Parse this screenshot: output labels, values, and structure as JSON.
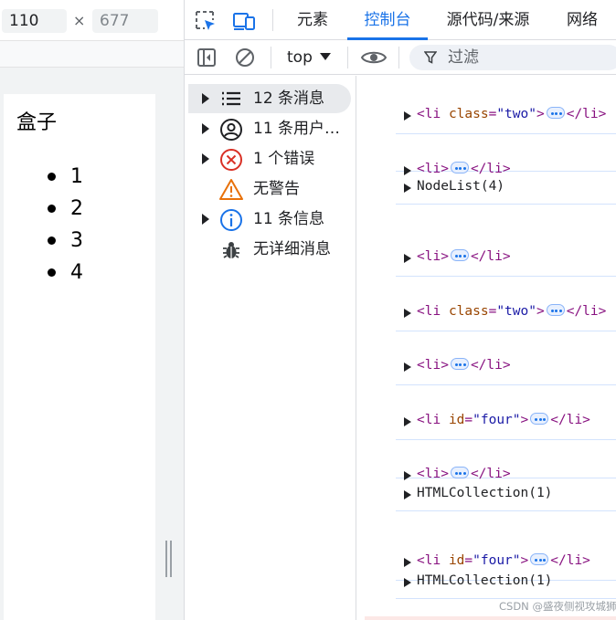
{
  "viewport": {
    "width_value": "110",
    "times": "×",
    "height_placeholder": "677"
  },
  "page": {
    "title": "盒子",
    "list_items": [
      "1",
      "2",
      "3",
      "4"
    ]
  },
  "devtools": {
    "tabs": {
      "elements": "元素",
      "console": "控制台",
      "sources": "源代码/来源",
      "network": "网络"
    },
    "active_tab": "控制台",
    "toolbar": {
      "context": "top",
      "filter_label": "过滤"
    },
    "sidebar": [
      {
        "label": "12 条消息",
        "icon": "list-icon",
        "expandable": true,
        "selected": true
      },
      {
        "label": "11 条用户…",
        "icon": "user-icon",
        "expandable": true,
        "selected": false
      },
      {
        "label": "1 个错误",
        "icon": "error-icon",
        "expandable": true,
        "selected": false
      },
      {
        "label": "无警告",
        "icon": "warning-icon",
        "expandable": false,
        "selected": false
      },
      {
        "label": "11 条信息",
        "icon": "info-icon",
        "expandable": true,
        "selected": false
      },
      {
        "label": "无详细消息",
        "icon": "bug-icon",
        "expandable": false,
        "selected": false
      }
    ],
    "console_entries": [
      {
        "kind": "element",
        "tag": "li",
        "attr": "class",
        "value": "two"
      },
      {
        "kind": "element",
        "tag": "li"
      },
      {
        "kind": "text",
        "text": "NodeList(4)"
      },
      {
        "kind": "element",
        "tag": "li"
      },
      {
        "kind": "element",
        "tag": "li",
        "attr": "class",
        "value": "two"
      },
      {
        "kind": "element",
        "tag": "li"
      },
      {
        "kind": "element",
        "tag": "li",
        "attr": "id",
        "value": "four"
      },
      {
        "kind": "element",
        "tag": "li"
      },
      {
        "kind": "text",
        "text": "HTMLCollection(1)"
      },
      {
        "kind": "element",
        "tag": "li",
        "attr": "id",
        "value": "four"
      },
      {
        "kind": "text",
        "text": "HTMLCollection(1)"
      }
    ]
  },
  "watermark": "CSDN @盛夜侧视攻城狮",
  "colors": {
    "accent": "#1a73e8",
    "tag": "#881280",
    "attr_name": "#994500",
    "attr_value": "#1a1aa6",
    "error": "#d93025",
    "warning": "#e8710a"
  }
}
